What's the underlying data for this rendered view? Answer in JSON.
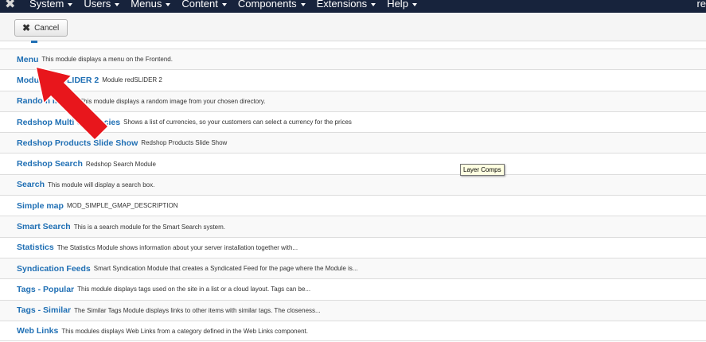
{
  "navbar": {
    "logo_icon": "joomla-icon",
    "menus": [
      "System",
      "Users",
      "Menus",
      "Content",
      "Components",
      "Extensions",
      "Help"
    ],
    "user_partial": "re"
  },
  "toolbar": {
    "cancel_label": "Cancel",
    "cancel_icon": "close-icon"
  },
  "modules": [
    {
      "title": "Menu",
      "desc": "This module displays a menu on the Frontend."
    },
    {
      "title": "Module redSLIDER 2",
      "desc": "Module redSLIDER 2"
    },
    {
      "title": "Random Image",
      "desc": "This module displays a random image from your chosen directory."
    },
    {
      "title": "Redshop Multi Currencies",
      "desc": "Shows a list of currencies, so your customers can select a currency for the prices"
    },
    {
      "title": "Redshop Products Slide Show",
      "desc": "Redshop Products Slide Show"
    },
    {
      "title": "Redshop Search",
      "desc": "Redshop Search Module"
    },
    {
      "title": "Search",
      "desc": "This module will display a search box."
    },
    {
      "title": "Simple map",
      "desc": "MOD_SIMPLE_GMAP_DESCRIPTION"
    },
    {
      "title": "Smart Search",
      "desc": "This is a search module for the Smart Search system."
    },
    {
      "title": "Statistics",
      "desc": "The Statistics Module shows information about your server installation together with..."
    },
    {
      "title": "Syndication Feeds",
      "desc": "Smart Syndication Module that creates a Syndicated Feed for the page where the Module is..."
    },
    {
      "title": "Tags - Popular",
      "desc": "This module displays tags used on the site in a list or a cloud layout. Tags can be..."
    },
    {
      "title": "Tags - Similar",
      "desc": "The Similar Tags Module displays links to other items with similar tags. The closeness..."
    },
    {
      "title": "Web Links",
      "desc": "This modules displays Web Links from a category defined in the Web Links component."
    }
  ],
  "tooltip": "Layer Comps",
  "annotation": {
    "icon": "red-arrow-icon",
    "color": "#e8161c"
  },
  "colors": {
    "navbar": "#17233c",
    "link": "#1f6fb4"
  }
}
